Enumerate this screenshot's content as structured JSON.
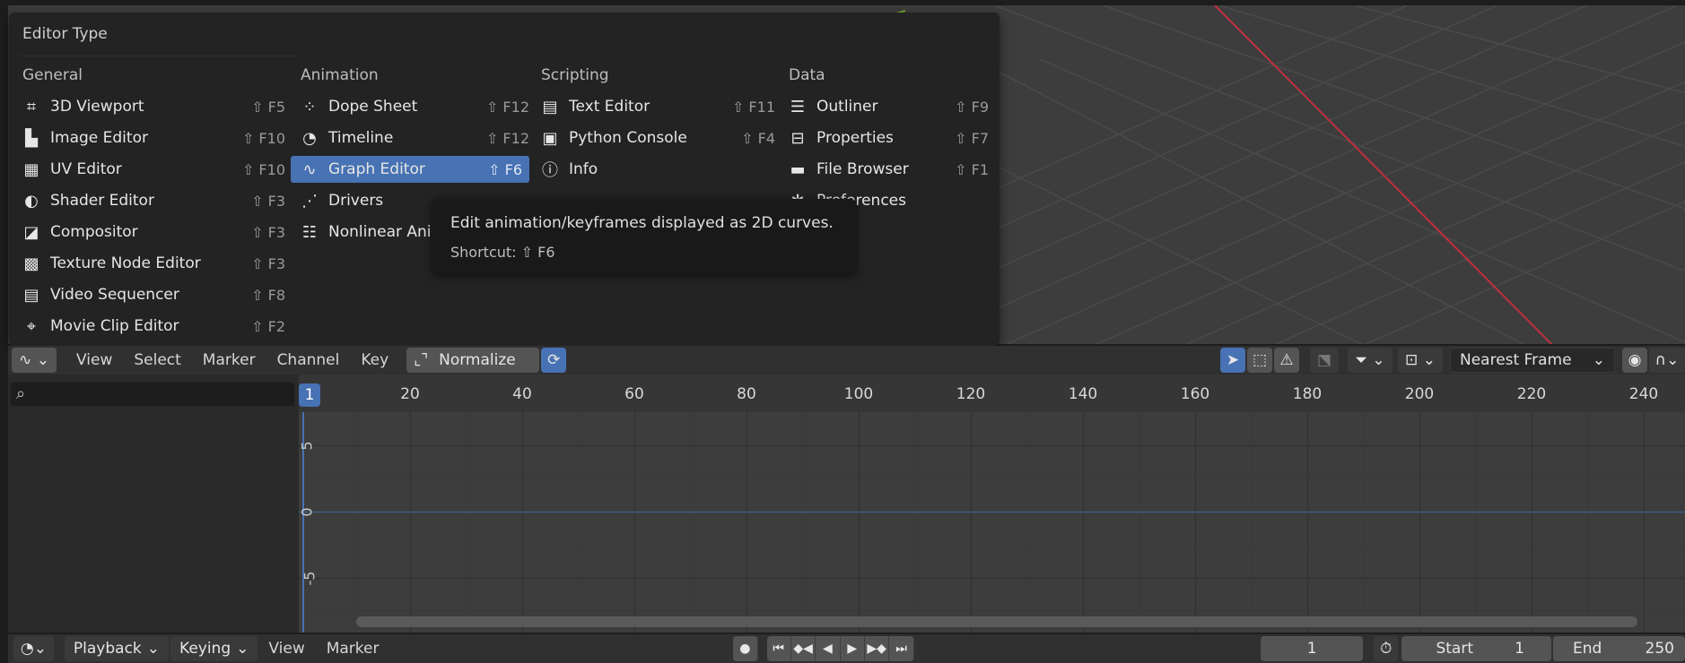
{
  "menu": {
    "title": "Editor Type",
    "columns": [
      {
        "heading": "General",
        "items": [
          {
            "icon": "3d-viewport-icon",
            "label": "3D Viewport",
            "shortcut": "⇧ F5"
          },
          {
            "icon": "image-editor-icon",
            "label": "Image Editor",
            "shortcut": "⇧ F10"
          },
          {
            "icon": "uv-editor-icon",
            "label": "UV Editor",
            "shortcut": "⇧ F10"
          },
          {
            "icon": "shader-editor-icon",
            "label": "Shader Editor",
            "shortcut": "⇧ F3"
          },
          {
            "icon": "compositor-icon",
            "label": "Compositor",
            "shortcut": "⇧ F3"
          },
          {
            "icon": "texture-node-editor-icon",
            "label": "Texture Node Editor",
            "shortcut": "⇧ F3"
          },
          {
            "icon": "video-sequencer-icon",
            "label": "Video Sequencer",
            "shortcut": "⇧ F8"
          },
          {
            "icon": "movie-clip-editor-icon",
            "label": "Movie Clip Editor",
            "shortcut": "⇧ F2"
          }
        ]
      },
      {
        "heading": "Animation",
        "items": [
          {
            "icon": "dope-sheet-icon",
            "label": "Dope Sheet",
            "shortcut": "⇧ F12"
          },
          {
            "icon": "timeline-icon",
            "label": "Timeline",
            "shortcut": "⇧ F12"
          },
          {
            "icon": "graph-editor-icon",
            "label": "Graph Editor",
            "shortcut": "⇧ F6"
          },
          {
            "icon": "drivers-icon",
            "label": "Drivers",
            "shortcut": ""
          },
          {
            "icon": "nonlinear-animation-icon",
            "label": "Nonlinear Ani",
            "shortcut": ""
          }
        ]
      },
      {
        "heading": "Scripting",
        "items": [
          {
            "icon": "text-editor-icon",
            "label": "Text Editor",
            "shortcut": "⇧ F11"
          },
          {
            "icon": "python-console-icon",
            "label": "Python Console",
            "shortcut": "⇧ F4"
          },
          {
            "icon": "info-icon",
            "label": "Info",
            "shortcut": ""
          }
        ]
      },
      {
        "heading": "Data",
        "items": [
          {
            "icon": "outliner-icon",
            "label": "Outliner",
            "shortcut": "⇧ F9"
          },
          {
            "icon": "properties-icon",
            "label": "Properties",
            "shortcut": "⇧ F7"
          },
          {
            "icon": "file-browser-icon",
            "label": "File Browser",
            "shortcut": "⇧ F1"
          },
          {
            "icon": "preferences-icon",
            "label": "Preferences",
            "shortcut": ""
          }
        ]
      }
    ]
  },
  "tooltip": {
    "text": "Edit animation/keyframes displayed as 2D curves.",
    "shortcut": "Shortcut: ⇧ F6"
  },
  "graph_header": {
    "menus": [
      "View",
      "Select",
      "Marker",
      "Channel",
      "Key"
    ],
    "normalize": "Normalize",
    "snap": "Nearest Frame"
  },
  "graph": {
    "current_frame": "1",
    "frame_ticks": [
      "20",
      "40",
      "60",
      "80",
      "100",
      "120",
      "140",
      "160",
      "180",
      "200",
      "220",
      "240"
    ],
    "value_ticks": [
      "5",
      "0",
      "-5"
    ]
  },
  "timeline_header": {
    "playback": "Playback",
    "keying": "Keying",
    "view": "View",
    "marker": "Marker",
    "frame": "1",
    "start_label": "Start",
    "start_value": "1",
    "end_label": "End",
    "end_value": "250"
  },
  "colors": {
    "accent": "#4772b3",
    "x_axis": "#c03040",
    "y_axis": "#6fa830"
  }
}
